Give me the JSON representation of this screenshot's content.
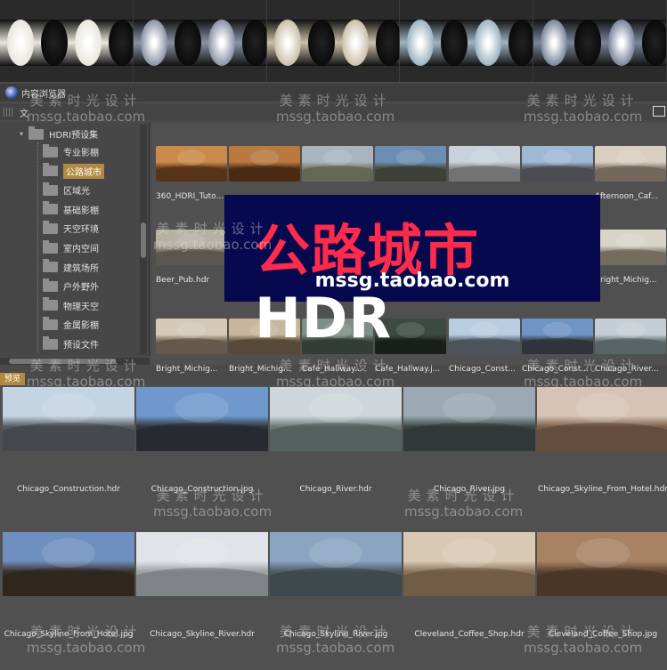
{
  "top_strip": {
    "thumbs": [
      {
        "tone": "#e8e6dc"
      },
      {
        "tone": "#8a93a6"
      },
      {
        "tone": "#cbbfa9"
      },
      {
        "tone": "#9db3c2"
      },
      {
        "tone": "#7a859b"
      }
    ]
  },
  "window": {
    "title": "内容浏览器",
    "menu_label": "文"
  },
  "tree": {
    "root_label": "HDRI预设集",
    "items": [
      {
        "label": "专业影棚"
      },
      {
        "label": "公路城市",
        "selected": true
      },
      {
        "label": "区域光"
      },
      {
        "label": "基础影棚"
      },
      {
        "label": "天空环境"
      },
      {
        "label": "室内空间"
      },
      {
        "label": "建筑场所"
      },
      {
        "label": "户外野外"
      },
      {
        "label": "物理天空"
      },
      {
        "label": "金属影棚"
      },
      {
        "label": "预设文件"
      }
    ]
  },
  "grid": {
    "files": [
      {
        "name": "360_HDRI_Tuto...",
        "sky": "#c98a4a",
        "ground": "#6b3f1f"
      },
      {
        "name": "",
        "sky": "#b9793f",
        "ground": "#5b3418"
      },
      {
        "name": "",
        "sky": "#a9b4bd",
        "ground": "#7b7d6a"
      },
      {
        "name": "",
        "sky": "#6d8eb3",
        "ground": "#4a4f42"
      },
      {
        "name": "",
        "sky": "#c9d2da",
        "ground": "#8a8d8f"
      },
      {
        "name": "",
        "sky": "#9fb8d6",
        "ground": "#5c5f66"
      },
      {
        "name": "Afternoon_Caf...",
        "sky": "#d8cfc0",
        "ground": "#8b7f70"
      },
      {
        "name": "Beer_Pub.hdr",
        "sky": "#b7b0a4",
        "ground": "#6f6a60"
      },
      {
        "name": "",
        "sky": "#9a9a9a",
        "ground": "#5a5a5a"
      },
      {
        "name": "",
        "sky": "#9a9a9a",
        "ground": "#5a5a5a"
      },
      {
        "name": "",
        "sky": "#9a9a9a",
        "ground": "#5a5a5a"
      },
      {
        "name": "",
        "sky": "#9a9a9a",
        "ground": "#5a5a5a"
      },
      {
        "name": "",
        "sky": "#9a9a9a",
        "ground": "#5a5a5a"
      },
      {
        "name": "Bright_Michig...",
        "sky": "#d9d4c8",
        "ground": "#8e8575"
      },
      {
        "name": "Bright_Michig...",
        "sky": "#d4c9b6",
        "ground": "#7a6d5b"
      },
      {
        "name": "Bright_Michig...",
        "sky": "#c7b69b",
        "ground": "#6a5a44"
      },
      {
        "name": "Cafe_Hallway...",
        "sky": "#7d8f86",
        "ground": "#3f4a44"
      },
      {
        "name": "Cafe_Hallway.j...",
        "sky": "#3d4a44",
        "ground": "#1f2622"
      },
      {
        "name": "Chicago_Const...",
        "sky": "#b9cde0",
        "ground": "#5f6670"
      },
      {
        "name": "Chicago_Const...",
        "sky": "#6f95c7",
        "ground": "#3a3f4a"
      },
      {
        "name": "Chicago_River...",
        "sky": "#c5ced4",
        "ground": "#6d7a7a"
      }
    ]
  },
  "preview": {
    "tab_label": "预览",
    "items": [
      {
        "name": "Chicago_Construction.hdr",
        "sky": "#c4d4e3",
        "ground": "#55595e"
      },
      {
        "name": "Chicago_Construction.jpg",
        "sky": "#6f99cc",
        "ground": "#30343b"
      },
      {
        "name": "Chicago_River.hdr",
        "sky": "#cfd6db",
        "ground": "#6a7774"
      },
      {
        "name": "Chicago_River.jpg",
        "sky": "#9aa9b3",
        "ground": "#3b4644"
      },
      {
        "name": "Chicago_Skyline_From_Hotel.hdr",
        "sky": "#d6c3b3",
        "ground": "#7a5f4a"
      },
      {
        "name": "Chicago_Skyline_From_Hotel.jpg",
        "sky": "#6e8fbf",
        "ground": "#3a2f25"
      },
      {
        "name": "Chicago_Skyline_River.hdr",
        "sky": "#e0e4e8",
        "ground": "#9aa0a4"
      },
      {
        "name": "Chicago_Skyline_River.jpg",
        "sky": "#8aa4c2",
        "ground": "#4d5a5f"
      },
      {
        "name": "Cleveland_Coffee_Shop.hdr",
        "sky": "#d9c9b3",
        "ground": "#8a7256"
      },
      {
        "name": "Cleveland_Coffee_Shop.jpg",
        "sky": "#a88363",
        "ground": "#5a4230"
      }
    ]
  },
  "banner": {
    "headline_zh": "公路城市",
    "headline_en": "HDR",
    "shop": "mssg.taobao.com",
    "bg": "#07094f",
    "accent": "#ff2b4a"
  },
  "watermark": {
    "line1": "美素时光设计",
    "line2": "mssg.taobao.com"
  }
}
